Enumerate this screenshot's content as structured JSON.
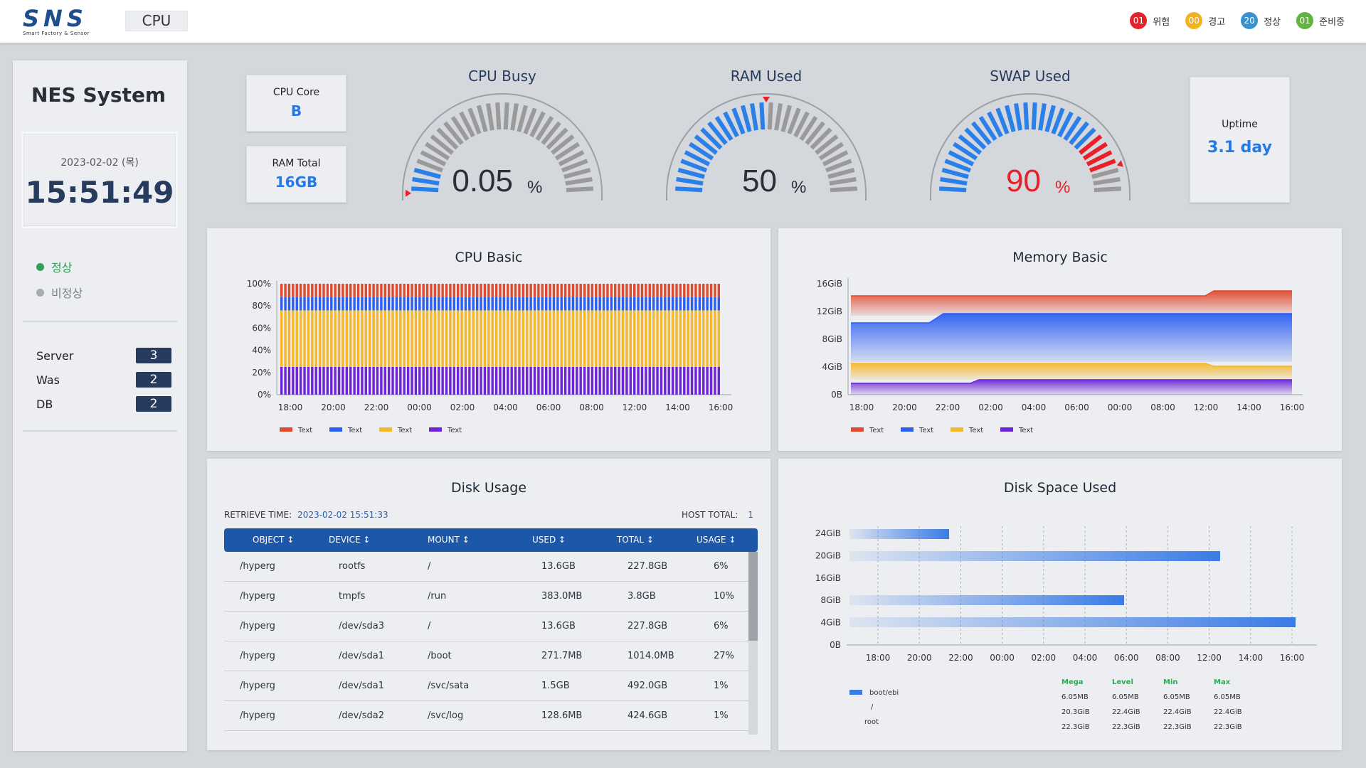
{
  "header": {
    "logo_text": "SNS",
    "logo_subtitle": "Smart Factory & Sensor",
    "page_tab": "CPU",
    "statuses": [
      {
        "count": "01",
        "label": "위험",
        "color": "#e8202a"
      },
      {
        "count": "00",
        "label": "경고",
        "color": "#f1b320"
      },
      {
        "count": "20",
        "label": "정상",
        "color": "#3593d3"
      },
      {
        "count": "01",
        "label": "준비중",
        "color": "#62b43c"
      }
    ]
  },
  "sidebar": {
    "title": "NES System",
    "date": "2023-02-02 (목)",
    "time": "15:51:49",
    "legend": [
      {
        "label": "정상",
        "color": "#2f9e56"
      },
      {
        "label": "비정상",
        "color": "#a8abaf"
      }
    ],
    "counts": [
      {
        "label": "Server",
        "value": "3"
      },
      {
        "label": "Was",
        "value": "2"
      },
      {
        "label": "DB",
        "value": "2"
      }
    ]
  },
  "stats": {
    "cpu_core": {
      "label": "CPU Core",
      "value": "B"
    },
    "ram_total": {
      "label": "RAM Total",
      "value": "16GB"
    },
    "uptime": {
      "label": "Uptime",
      "value": "3.1 day"
    }
  },
  "gauges": [
    {
      "title": "CPU Busy",
      "value": "0.05",
      "unit": "%",
      "percent": 0.05,
      "value_color": "#2a2f38",
      "unit_color": "#2a2f38"
    },
    {
      "title": "RAM Used",
      "value": "50",
      "unit": "%",
      "percent": 50,
      "value_color": "#2a2f38",
      "unit_color": "#2a2f38"
    },
    {
      "title": "SWAP Used",
      "value": "90",
      "unit": "%",
      "percent": 90,
      "value_color": "#e8202a",
      "unit_color": "#e8202a"
    }
  ],
  "chart_data": [
    {
      "type": "bar",
      "title": "CPU Basic",
      "x_ticks": [
        "18:00",
        "20:00",
        "22:00",
        "00:00",
        "02:00",
        "04:00",
        "06:00",
        "08:00",
        "12:00",
        "14:00",
        "16:00"
      ],
      "y_ticks": [
        "100%",
        "80%",
        "60%",
        "40%",
        "20%",
        "0%"
      ],
      "ylim": [
        0,
        100
      ],
      "stacked": true,
      "series": [
        {
          "name": "Text",
          "color": "#e04a2f",
          "value": 12
        },
        {
          "name": "Text",
          "color": "#2b5ef2",
          "value": 12
        },
        {
          "name": "Text",
          "color": "#f7b72a",
          "value": 51
        },
        {
          "name": "Text",
          "color": "#6b25d6",
          "value": 25
        }
      ]
    },
    {
      "type": "area",
      "title": "Memory Basic",
      "x_ticks": [
        "18:00",
        "20:00",
        "22:00",
        "02:00",
        "04:00",
        "06:00",
        "00:00",
        "08:00",
        "12:00",
        "14:00",
        "16:00"
      ],
      "y_ticks": [
        "16GiB",
        "12GiB",
        "8GiB",
        "4GiB",
        "0B"
      ],
      "series": [
        {
          "name": "Text",
          "color": "#e04a2f"
        },
        {
          "name": "Text",
          "color": "#2b5ef2"
        },
        {
          "name": "Text",
          "color": "#f7b72a"
        },
        {
          "name": "Text",
          "color": "#6b25d6"
        }
      ]
    },
    {
      "type": "bar",
      "orientation": "horizontal",
      "title": "Disk Space Used",
      "x_ticks": [
        "18:00",
        "20:00",
        "22:00",
        "00:00",
        "02:00",
        "04:00",
        "06:00",
        "08:00",
        "12:00",
        "14:00",
        "16:00"
      ],
      "y_ticks": [
        "24GiB",
        "20GiB",
        "16GiB",
        "8GiB",
        "4GiB",
        "0B"
      ],
      "legend": [
        "boot/ebi",
        "/",
        "root"
      ],
      "stats_headers": [
        "Mega",
        "Level",
        "Min",
        "Max"
      ],
      "stats_rows": [
        [
          "6.05MB",
          "6.05MB",
          "6.05MB",
          "6.05MB"
        ],
        [
          "20.3GiB",
          "22.4GiB",
          "22.4GiB",
          "22.4GiB"
        ],
        [
          "22.3GiB",
          "22.3GiB",
          "22.3GiB",
          "22.3GiB"
        ]
      ]
    }
  ],
  "disk_usage": {
    "title": "Disk Usage",
    "retrieve_label": "RETRIEVE TIME:",
    "retrieve_value": "2023-02-02 15:51:33",
    "host_label": "HOST TOTAL:",
    "host_value": "1",
    "columns": [
      "OBJECT",
      "DEVICE",
      "MOUNT",
      "USED",
      "TOTAL",
      "USAGE"
    ],
    "rows": [
      [
        "/hyperg",
        "rootfs",
        "/",
        "13.6GB",
        "227.8GB",
        "6%"
      ],
      [
        "/hyperg",
        "tmpfs",
        "/run",
        "383.0MB",
        "3.8GB",
        "10%"
      ],
      [
        "/hyperg",
        "/dev/sda3",
        "/",
        "13.6GB",
        "227.8GB",
        "6%"
      ],
      [
        "/hyperg",
        "/dev/sda1",
        "/boot",
        "271.7MB",
        "1014.0MB",
        "27%"
      ],
      [
        "/hyperg",
        "/dev/sda1",
        "/svc/sata",
        "1.5GB",
        "492.0GB",
        "1%"
      ],
      [
        "/hyperg",
        "/dev/sda2",
        "/svc/log",
        "128.6MB",
        "424.6GB",
        "1%"
      ]
    ]
  }
}
